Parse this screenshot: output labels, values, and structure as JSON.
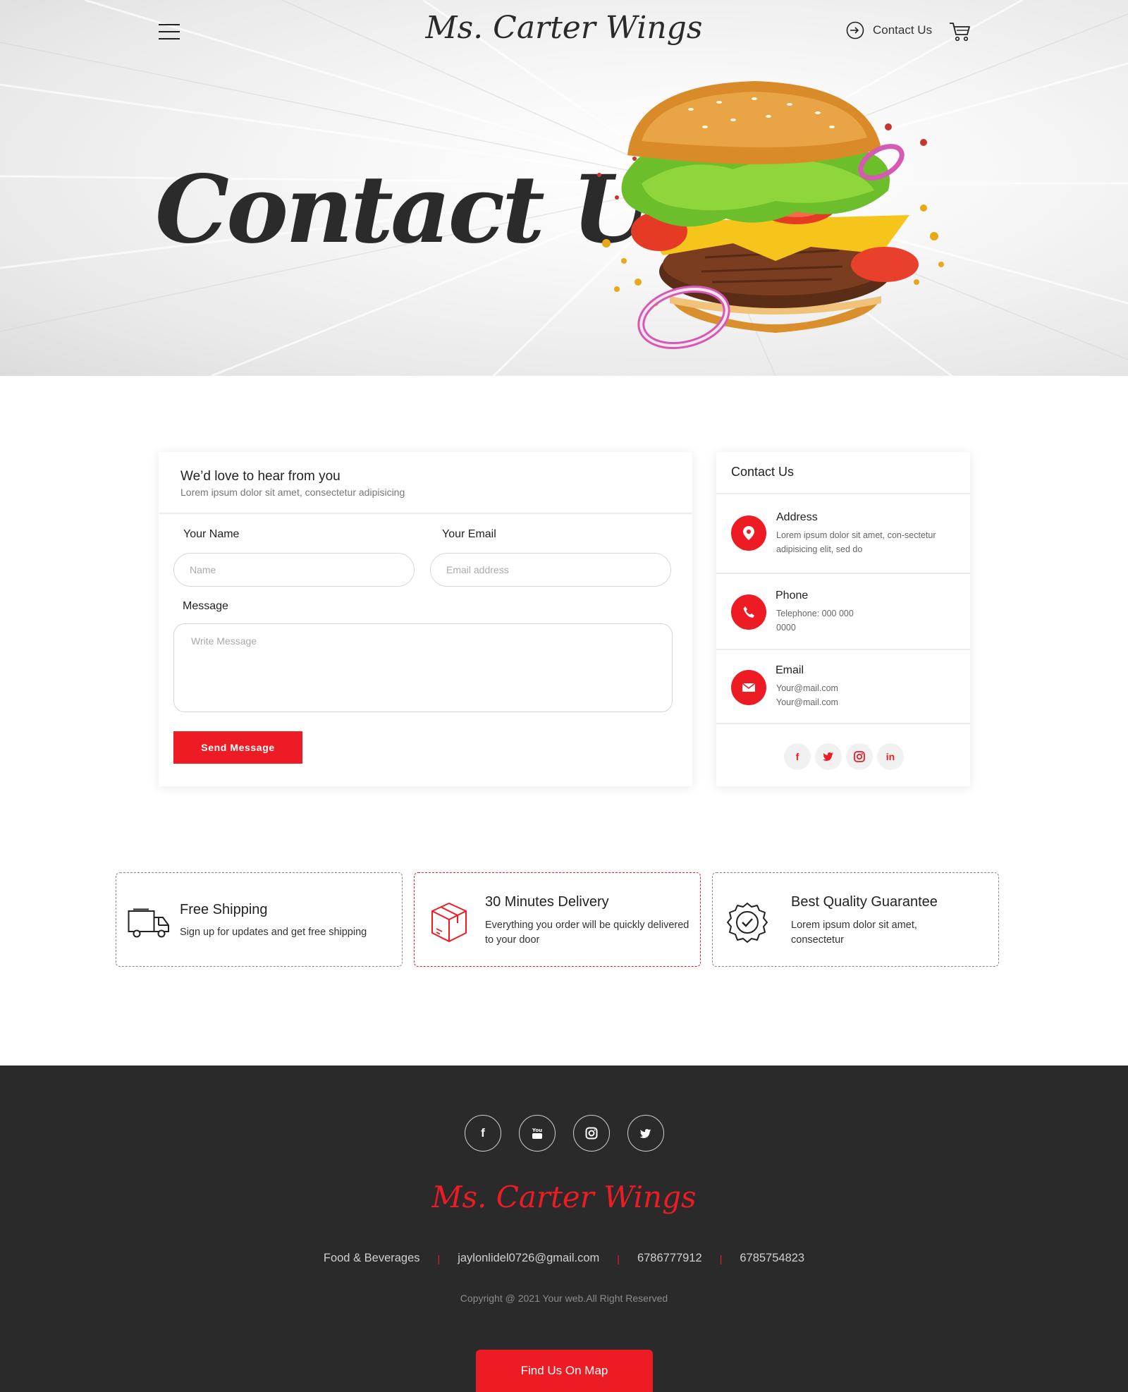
{
  "header": {
    "brand": "Ms. Carter Wings",
    "contact_link": "Contact Us"
  },
  "hero": {
    "title": "Contact Us"
  },
  "form": {
    "heading": "We’d love to hear from you",
    "subheading": "Lorem ipsum dolor sit amet, consectetur adipisicing",
    "name_label": "Your Name",
    "name_placeholder": "Name",
    "email_label": "Your Email",
    "email_placeholder": "Email address",
    "message_label": "Message",
    "message_placeholder": "Write Message",
    "submit_label": "Send Message"
  },
  "contact_info": {
    "title": "Contact Us",
    "items": [
      {
        "title": "Address",
        "text": "Lorem ipsum dolor sit amet, con-sectetur adipisicing elit, sed do",
        "icon": "map-pin-icon"
      },
      {
        "title": "Phone",
        "text": "Telephone: 000 000 0000",
        "icon": "phone-icon"
      },
      {
        "title": "Email",
        "text": "Your@mail.com Your@mail.com",
        "icon": "envelope-icon"
      }
    ],
    "social": [
      "f",
      "t",
      "ig",
      "in"
    ]
  },
  "features": [
    {
      "title": "Free Shipping",
      "text": "Sign up for updates and get free shipping",
      "icon": "truck-icon"
    },
    {
      "title": "30 Minutes Delivery",
      "text": "Everything you order will be quickly delivered to your door",
      "icon": "package-icon"
    },
    {
      "title": "Best Quality Guarantee",
      "text": "Lorem ipsum dolor sit amet, consectetur",
      "icon": "quality-badge-icon"
    }
  ],
  "footer": {
    "brand": "Ms. Carter Wings",
    "links": [
      "Food & Beverages",
      "jaylonlidel0726@gmail.com",
      "6786777912",
      "6785754823"
    ],
    "copyright": "Copyright @ 2021 Your web.All Right Reserved",
    "map_button": "Find Us On Map"
  },
  "colors": {
    "accent": "#ed1c24",
    "footer_bg": "#2a2a2a"
  }
}
